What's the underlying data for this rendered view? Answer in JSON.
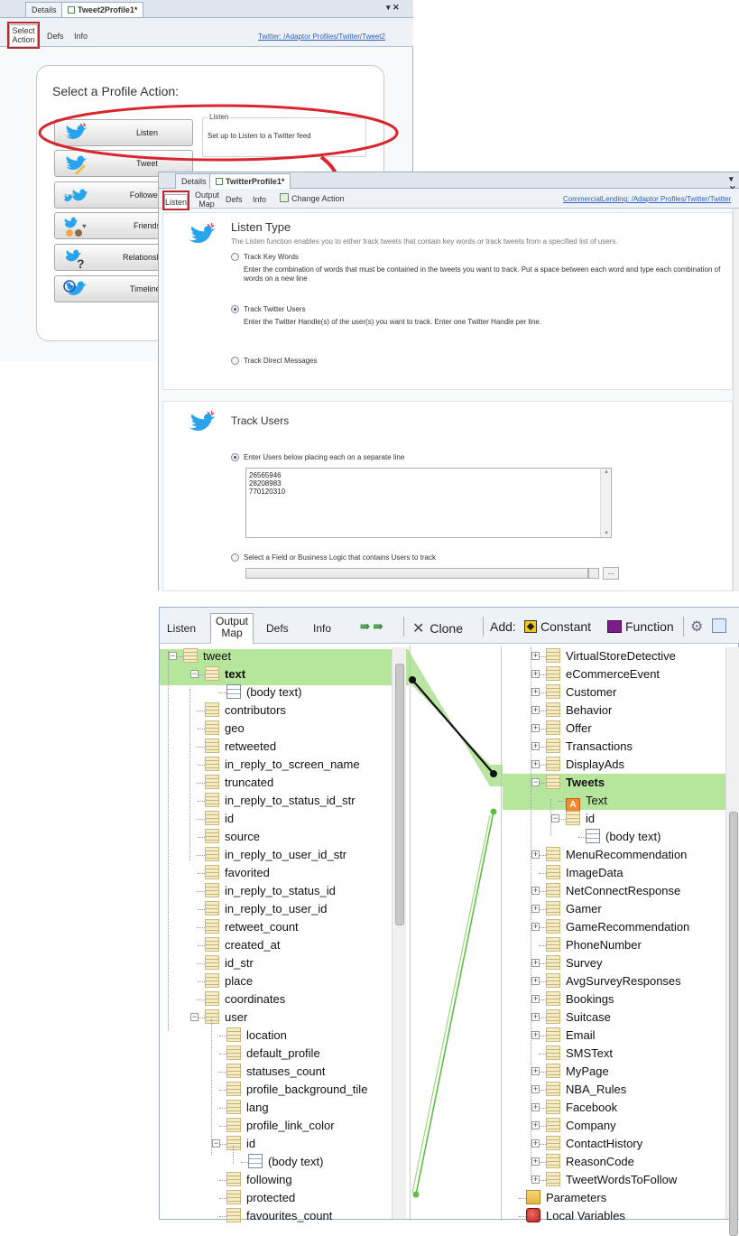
{
  "win1": {
    "tabs": [
      {
        "label": "Details"
      },
      {
        "label": "Tweet2Profile1*"
      }
    ],
    "close_glyph": "▾ ✕",
    "subtabs": [
      {
        "label": "Select Action"
      },
      {
        "label": "Defs"
      },
      {
        "label": "Info"
      }
    ],
    "path": "Twitter: /Adaptor Profiles/Twitter/Tweet2",
    "heading": "Select a Profile Action:",
    "actions": [
      {
        "label": "Listen",
        "icon": "twitter-bird-icon"
      },
      {
        "label": "Tweet",
        "icon": "twitter-pen-icon"
      },
      {
        "label": "Followers",
        "icon": "followers-icon"
      },
      {
        "label": "Friends",
        "icon": "friends-icon"
      },
      {
        "label": "Relationships",
        "icon": "relationships-icon"
      },
      {
        "label": "Timelines",
        "icon": "timelines-icon"
      }
    ],
    "detail_title": "Listen",
    "detail_desc": "Set up to Listen to a Twitter feed"
  },
  "win2": {
    "tabs": [
      {
        "label": "Details"
      },
      {
        "label": "TwitterProfile1*"
      }
    ],
    "subtabs": [
      {
        "label": "Listen"
      },
      {
        "label": "Output Map"
      },
      {
        "label": "Defs"
      },
      {
        "label": "Info"
      }
    ],
    "change_action": "Change Action",
    "path": "CommercialLending: /Adaptor Profiles/Twitter/Twitter",
    "listen_type": {
      "title": "Listen Type",
      "desc": "The Listen function enables you to either track tweets that contain key words or track tweets from a specified list of users.",
      "options": [
        {
          "label": "Track Key Words",
          "desc": "Enter the combination of words that must be contained in the tweets you want to track. Put a space between each word and type each combination of words on a new line",
          "selected": false
        },
        {
          "label": "Track Twitter Users",
          "desc": "Enter the Twitter Handle(s) of the user(s) you want to track. Enter one Twitter Handle per line.",
          "selected": true
        },
        {
          "label": "Track Direct Messages",
          "desc": "",
          "selected": false
        }
      ]
    },
    "track_users": {
      "title": "Track Users",
      "opt1": "Enter Users below placing each on a separate line",
      "users_text": "26565946\n28208983\n770120310",
      "opt2": "Select a Field or Business Logic that contains Users to track",
      "browse": "..."
    }
  },
  "win3": {
    "tabs": [
      {
        "label": "Listen"
      },
      {
        "label": "Output Map"
      },
      {
        "label": "Defs"
      },
      {
        "label": "Info"
      }
    ],
    "toolbar": {
      "clone": "Clone",
      "add": "Add:",
      "constant": "Constant",
      "function": "Function"
    },
    "left_tree": [
      {
        "label": "tweet",
        "kind": "node"
      },
      {
        "label": "text",
        "kind": "node",
        "bold": true
      },
      {
        "label": "(body text)",
        "kind": "doc"
      },
      {
        "label": "contributors",
        "kind": "node"
      },
      {
        "label": "geo",
        "kind": "node"
      },
      {
        "label": "retweeted",
        "kind": "node"
      },
      {
        "label": "in_reply_to_screen_name",
        "kind": "node"
      },
      {
        "label": "truncated",
        "kind": "node"
      },
      {
        "label": "in_reply_to_status_id_str",
        "kind": "node"
      },
      {
        "label": "id",
        "kind": "node"
      },
      {
        "label": "source",
        "kind": "node"
      },
      {
        "label": "in_reply_to_user_id_str",
        "kind": "node"
      },
      {
        "label": "favorited",
        "kind": "node"
      },
      {
        "label": "in_reply_to_status_id",
        "kind": "node"
      },
      {
        "label": "in_reply_to_user_id",
        "kind": "node"
      },
      {
        "label": "retweet_count",
        "kind": "node"
      },
      {
        "label": "created_at",
        "kind": "node"
      },
      {
        "label": "id_str",
        "kind": "node"
      },
      {
        "label": "place",
        "kind": "node"
      },
      {
        "label": "coordinates",
        "kind": "node"
      },
      {
        "label": "user",
        "kind": "node"
      },
      {
        "label": "location",
        "kind": "node"
      },
      {
        "label": "default_profile",
        "kind": "node"
      },
      {
        "label": "statuses_count",
        "kind": "node"
      },
      {
        "label": "profile_background_tile",
        "kind": "node"
      },
      {
        "label": "lang",
        "kind": "node"
      },
      {
        "label": "profile_link_color",
        "kind": "node"
      },
      {
        "label": "id",
        "kind": "node"
      },
      {
        "label": "(body text)",
        "kind": "doc"
      },
      {
        "label": "following",
        "kind": "node"
      },
      {
        "label": "protected",
        "kind": "node"
      },
      {
        "label": "favourites_count",
        "kind": "node"
      }
    ],
    "right_tree": [
      {
        "label": "VirtualStoreDetective",
        "kind": "node"
      },
      {
        "label": "eCommerceEvent",
        "kind": "node"
      },
      {
        "label": "Customer",
        "kind": "node"
      },
      {
        "label": "Behavior",
        "kind": "node"
      },
      {
        "label": "Offer",
        "kind": "node"
      },
      {
        "label": "Transactions",
        "kind": "node"
      },
      {
        "label": "DisplayAds",
        "kind": "node"
      },
      {
        "label": "Tweets",
        "kind": "node",
        "bold": true
      },
      {
        "label": "Text",
        "kind": "attr"
      },
      {
        "label": "id",
        "kind": "node"
      },
      {
        "label": "(body text)",
        "kind": "doc"
      },
      {
        "label": "MenuRecommendation",
        "kind": "node"
      },
      {
        "label": "ImageData",
        "kind": "node"
      },
      {
        "label": "NetConnectResponse",
        "kind": "node"
      },
      {
        "label": "Gamer",
        "kind": "node"
      },
      {
        "label": "GameRecommendation",
        "kind": "node"
      },
      {
        "label": "PhoneNumber",
        "kind": "node"
      },
      {
        "label": "Survey",
        "kind": "node"
      },
      {
        "label": "AvgSurveyResponses",
        "kind": "node"
      },
      {
        "label": "Bookings",
        "kind": "node"
      },
      {
        "label": "Suitcase",
        "kind": "node"
      },
      {
        "label": "Email",
        "kind": "node"
      },
      {
        "label": "SMSText",
        "kind": "node"
      },
      {
        "label": "MyPage",
        "kind": "node"
      },
      {
        "label": "NBA_Rules",
        "kind": "node"
      },
      {
        "label": "Facebook",
        "kind": "node"
      },
      {
        "label": "Company",
        "kind": "node"
      },
      {
        "label": "ContactHistory",
        "kind": "node"
      },
      {
        "label": "ReasonCode",
        "kind": "node"
      },
      {
        "label": "TweetWordsToFollow",
        "kind": "node"
      },
      {
        "label": "Parameters",
        "kind": "folder"
      },
      {
        "label": "Local Variables",
        "kind": "lvars"
      }
    ]
  },
  "colors": {
    "highlight_red": "#c0282e",
    "map_green": "#7ecb5a",
    "twitter_blue": "#2aa3ef"
  }
}
